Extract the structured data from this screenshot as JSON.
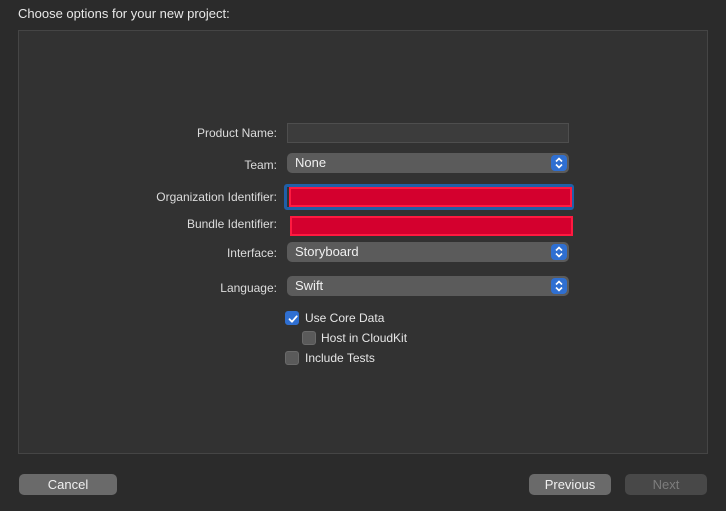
{
  "dialog": {
    "title": "Choose options for your new project:"
  },
  "form": {
    "product_name": {
      "label": "Product Name:",
      "value": ""
    },
    "team": {
      "label": "Team:",
      "selected": "None"
    },
    "organization_identifier": {
      "label": "Organization Identifier:"
    },
    "bundle_identifier": {
      "label": "Bundle Identifier:"
    },
    "interface": {
      "label": "Interface:",
      "selected": "Storyboard"
    },
    "language": {
      "label": "Language:",
      "selected": "Swift"
    },
    "options": {
      "use_core_data": {
        "label": "Use Core Data",
        "checked": true
      },
      "host_in_cloudkit": {
        "label": "Host in CloudKit",
        "checked": false
      },
      "include_tests": {
        "label": "Include Tests",
        "checked": false
      }
    }
  },
  "buttons": {
    "cancel": "Cancel",
    "previous": "Previous",
    "next": "Next"
  },
  "colors": {
    "accent": "#2f6fd1",
    "redaction": "#d4002e"
  }
}
